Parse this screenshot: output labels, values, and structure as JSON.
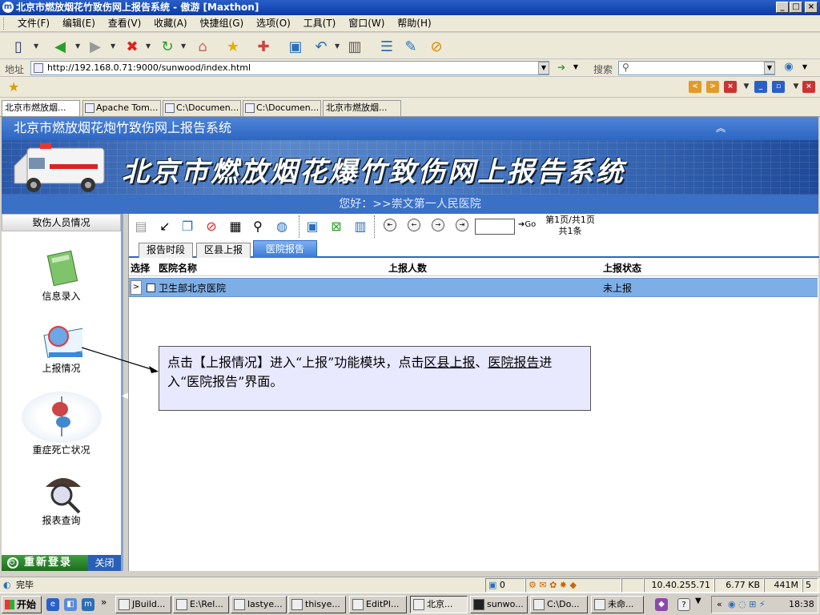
{
  "window": {
    "title": "北京市燃放烟花竹致伤网上报告系统 - 傲游 [Maxthon]",
    "app_icon": "m",
    "controls": [
      "_",
      "□",
      "×"
    ]
  },
  "menu": [
    "文件(F)",
    "编辑(E)",
    "查看(V)",
    "收藏(A)",
    "快捷组(G)",
    "选项(O)",
    "工具(T)",
    "窗口(W)",
    "帮助(H)"
  ],
  "address": {
    "label": "地址",
    "url": "http://192.168.0.71:9000/sunwood/index.html",
    "search_label": "搜索"
  },
  "tabs": [
    {
      "label": "北京市燃放烟...",
      "active": true
    },
    {
      "label": "Apache Tom...",
      "active": false
    },
    {
      "label": "C:\\Documen...",
      "active": false
    },
    {
      "label": "C:\\Documen...",
      "active": false
    },
    {
      "label": "北京市燃放烟...",
      "active": false
    }
  ],
  "app": {
    "header": "北京市燃放烟花炮竹致伤网上报告系统",
    "collapse_icon": "double-chevron-up-icon",
    "banner_title": "北京市燃放烟花爆竹致伤网上报告系统",
    "welcome": "您好：>>崇文第一人民医院"
  },
  "leftnav": {
    "heading": "致伤人员情况",
    "items": [
      {
        "label": "信息录入",
        "icon": "notebook-icon"
      },
      {
        "label": "上报情况",
        "icon": "report-clipboard-icon"
      },
      {
        "label": "重症死亡状况",
        "icon": "iv-drip-icon"
      },
      {
        "label": "报表查询",
        "icon": "magnifier-hat-icon"
      }
    ],
    "relogin": "重新登录",
    "close": "关闭"
  },
  "pager": {
    "go": "Go",
    "page_info": "第1页/共1页",
    "total": "共1条"
  },
  "subtabs": [
    {
      "label": "报告时段",
      "active": false
    },
    {
      "label": "区县上报",
      "active": false
    },
    {
      "label": "医院报告",
      "active": true
    }
  ],
  "table": {
    "headers": [
      "选择",
      "医院名称",
      "上报人数",
      "上报状态"
    ],
    "rows": [
      {
        "marker": ">",
        "name": "卫生部北京医院",
        "count": "",
        "status": "未上报"
      }
    ]
  },
  "annotation": {
    "part1": "点击【上报情况】进入“上报”功能模块，点击",
    "link1": "区县上报",
    "sep": "、",
    "link2": "医院报告",
    "part2": "进入“医院报告”界面。"
  },
  "status": {
    "text": "完毕",
    "count": "0",
    "ip": "10.40.255.71",
    "size": "6.77 KB",
    "mem": "441M",
    "num": "5"
  },
  "taskbar": {
    "start": "开始",
    "tasks": [
      "JBuild...",
      "E:\\Rel...",
      "lastye...",
      "thisye...",
      "EditPl...",
      "北京...",
      "sunwo...",
      "C:\\Do...",
      "未命..."
    ],
    "clock": "18:38"
  },
  "colors": {
    "accent": "#2d66c2",
    "row_highlight": "#7eaee6",
    "annotation_bg": "#e8e8ff"
  }
}
